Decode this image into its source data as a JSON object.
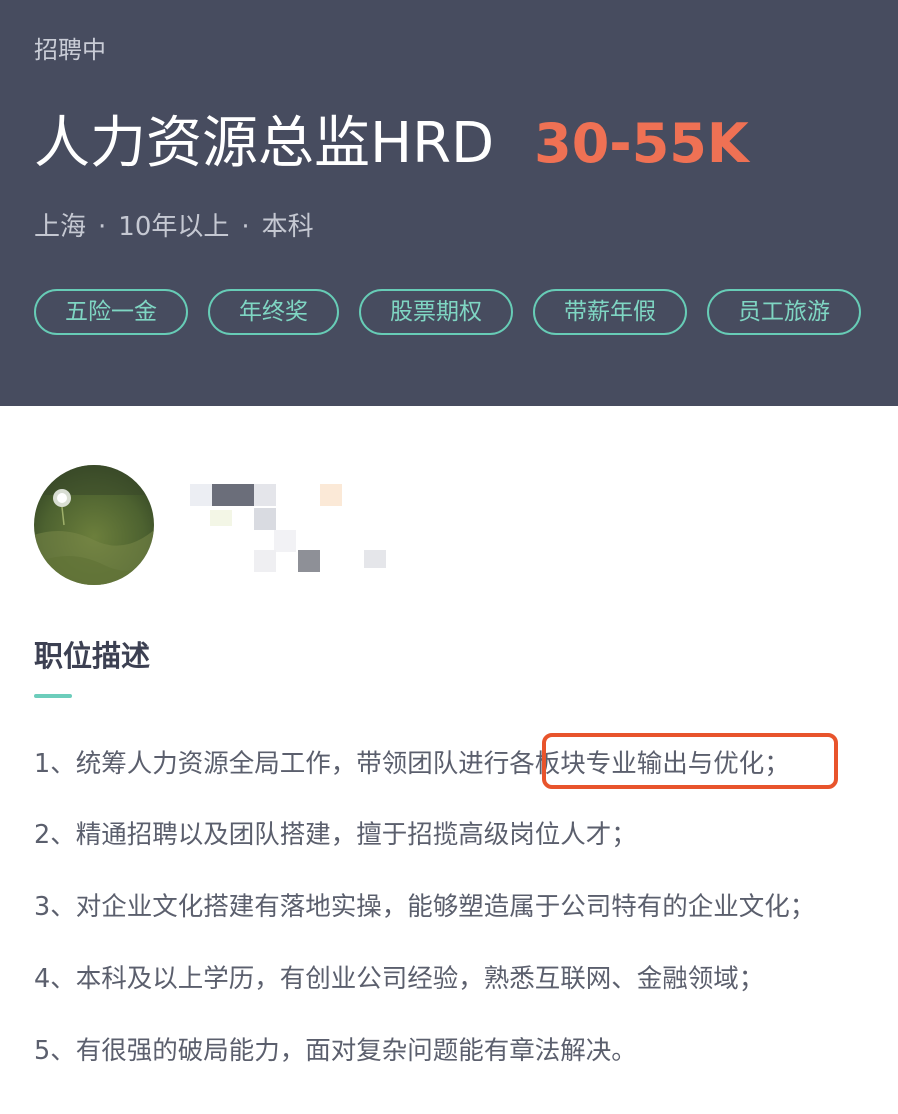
{
  "header": {
    "status": "招聘中",
    "title": "人力资源总监HRD",
    "salary": "30-55K",
    "meta": {
      "city": "上海",
      "experience": "10年以上",
      "education": "本科",
      "separator": "·"
    },
    "tags": [
      "五险一金",
      "年终奖",
      "股票期权",
      "带薪年假",
      "员工旅游"
    ]
  },
  "description": {
    "title": "职位描述",
    "items": [
      "1、统筹人力资源全局工作，带领团队进行各板块专业输出与优化；",
      "2、精通招聘以及团队搭建，擅于招揽高级岗位人才；",
      "3、对企业文化搭建有落地实操，能够塑造属于公司特有的企业文化；",
      "4、本科及以上学历，有创业公司经验，熟悉互联网、金融领域；",
      "5、有很强的破局能力，面对复杂问题能有章法解决。"
    ]
  },
  "colors": {
    "header_bg": "#474c5f",
    "salary": "#ef7154",
    "tag_border": "#67ccb6",
    "accent": "#6ccdbb",
    "highlight": "#e8542c"
  }
}
